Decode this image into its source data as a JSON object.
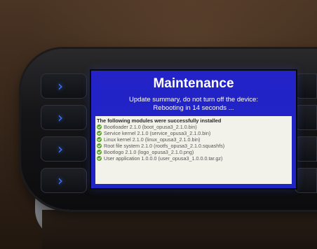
{
  "screen": {
    "title": "Maintenance",
    "line1": "Update summary, do not turn off the device:",
    "line2": "Rebooting in 14 seconds ...",
    "list_heading": "The following modules were successfully installed",
    "modules": [
      "Bootloader 2.1.0 (boot_opusa3_2.1.0.bin)",
      "Service kernel 2.1.0 (service_opusa3_2.1.0.bin)",
      "Linux kernel 2.1.0 (linux_opusa3_2.1.0.bin)",
      "Root file system 2.1.0 (rootfs_opusa3_2.1.0.squashfs)",
      "Bootlogo 2.1.0 (logo_opusa3_2.1.0.png)",
      "User application 1.0.0.0 (user_opusa3_1.0.0.0.tar.gz)"
    ]
  },
  "side_button_icons": [
    "chevron-right-icon",
    "chevron-right-icon",
    "chevron-right-icon",
    "chevron-right-icon"
  ],
  "colors": {
    "screen_blue": "#2323c8",
    "accent_blue": "#3b76ff",
    "check_green": "#5ba02a"
  }
}
